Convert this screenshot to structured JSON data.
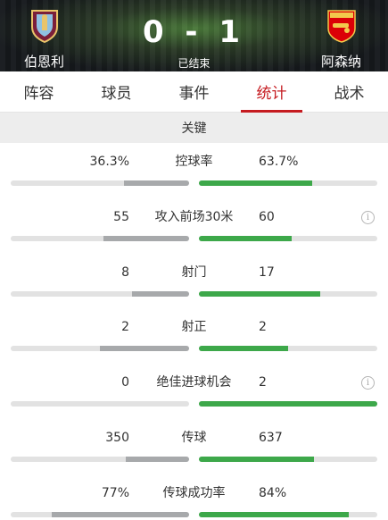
{
  "match": {
    "home_team": "伯恩利",
    "away_team": "阿森纳",
    "score": "0 - 1",
    "status": "已结束"
  },
  "tabs": [
    {
      "label": "阵容",
      "active": false
    },
    {
      "label": "球员",
      "active": false
    },
    {
      "label": "事件",
      "active": false
    },
    {
      "label": "统计",
      "active": true
    },
    {
      "label": "战术",
      "active": false
    }
  ],
  "section": {
    "title": "关键"
  },
  "stats": [
    {
      "label": "控球率",
      "home": "36.3%",
      "away": "63.7%",
      "home_share": 0.363,
      "away_share": 0.637,
      "info": false
    },
    {
      "label": "攻入前场30米",
      "home": "55",
      "away": "60",
      "home_share": 0.48,
      "away_share": 0.52,
      "info": true
    },
    {
      "label": "射门",
      "home": "8",
      "away": "17",
      "home_share": 0.32,
      "away_share": 0.68,
      "info": false
    },
    {
      "label": "射正",
      "home": "2",
      "away": "2",
      "home_share": 0.5,
      "away_share": 0.5,
      "info": false
    },
    {
      "label": "绝佳进球机会",
      "home": "0",
      "away": "2",
      "home_share": 0.0,
      "away_share": 1.0,
      "info": true
    },
    {
      "label": "传球",
      "home": "350",
      "away": "637",
      "home_share": 0.355,
      "away_share": 0.645,
      "info": false
    },
    {
      "label": "传球成功率",
      "home": "77%",
      "away": "84%",
      "home_share": 0.77,
      "away_share": 0.84,
      "info": false
    }
  ],
  "colors": {
    "accent": "#c51b20",
    "away_bar": "#3da84a",
    "home_bar": "#a7a9ab"
  },
  "icons": {
    "info": "info-icon"
  }
}
